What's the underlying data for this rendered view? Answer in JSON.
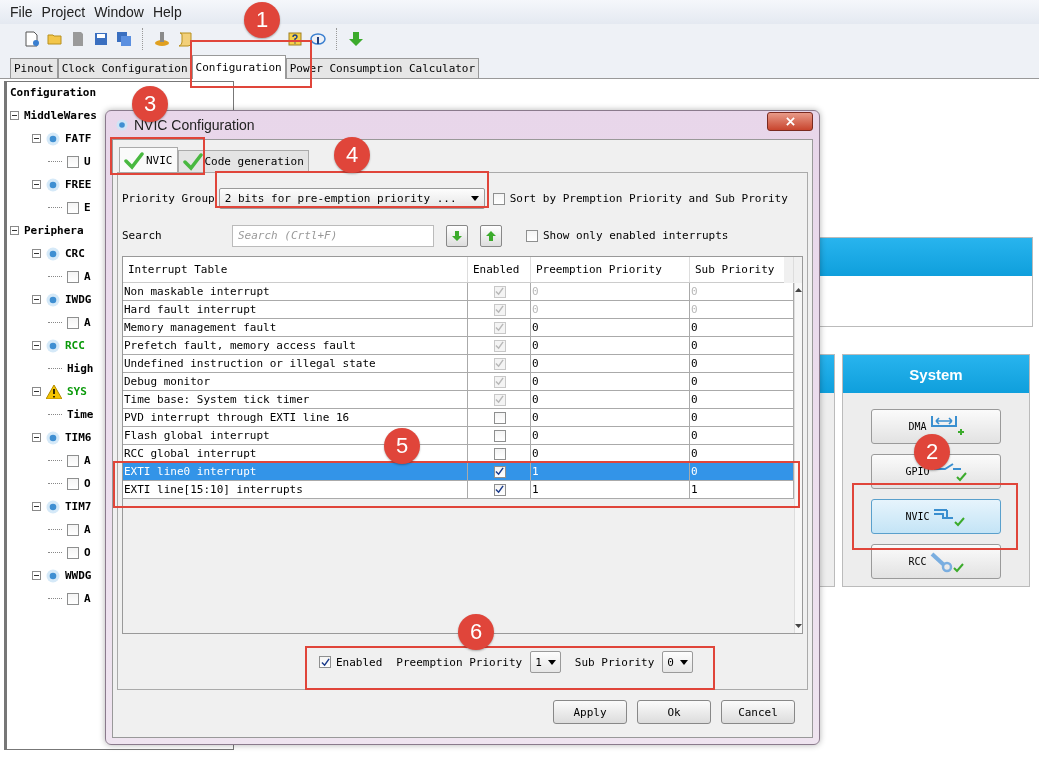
{
  "menu": [
    "File",
    "Project",
    "Window",
    "Help"
  ],
  "tabs": [
    {
      "label": "Pinout",
      "selected": false
    },
    {
      "label": "Clock Configuration",
      "selected": false
    },
    {
      "label": "Configuration",
      "selected": true
    },
    {
      "label": "Power Consumption Calculator",
      "selected": false
    }
  ],
  "tree": {
    "label": "Configuration",
    "children": [
      {
        "label": "MiddleWares",
        "kind": "group",
        "expanded": true,
        "children": [
          {
            "label": "FATF",
            "kind": "module",
            "expanded": true,
            "warning": false,
            "color": "#000000",
            "children": [
              {
                "label": "U",
                "kind": "checkbox",
                "checked": false
              }
            ]
          },
          {
            "label": "FREE",
            "kind": "module",
            "expanded": true,
            "warning": false,
            "color": "#000000",
            "children": [
              {
                "label": "E",
                "kind": "checkbox",
                "checked": false
              }
            ]
          }
        ]
      },
      {
        "label": "Periphera",
        "kind": "group",
        "expanded": true,
        "children": [
          {
            "label": "CRC",
            "kind": "module",
            "expanded": true,
            "warning": false,
            "color": "#000000",
            "children": [
              {
                "label": "A",
                "kind": "checkbox",
                "checked": false
              }
            ]
          },
          {
            "label": "IWDG",
            "kind": "module",
            "expanded": true,
            "warning": false,
            "color": "#000000",
            "children": [
              {
                "label": "A",
                "kind": "checkbox",
                "checked": false
              }
            ]
          },
          {
            "label": "RCC",
            "kind": "module",
            "expanded": true,
            "warning": false,
            "color": "#0a9a0a",
            "children": [
              {
                "label": "High",
                "kind": "text"
              }
            ]
          },
          {
            "label": "SYS",
            "kind": "module",
            "expanded": true,
            "warning": true,
            "color": "#0a9a0a",
            "children": [
              {
                "label": "Time",
                "kind": "text"
              }
            ]
          },
          {
            "label": "TIM6",
            "kind": "module",
            "expanded": true,
            "warning": false,
            "color": "#000000",
            "children": [
              {
                "label": "A",
                "kind": "checkbox",
                "checked": false
              },
              {
                "label": "O",
                "kind": "checkbox",
                "checked": false
              }
            ]
          },
          {
            "label": "TIM7",
            "kind": "module",
            "expanded": true,
            "warning": false,
            "color": "#000000",
            "children": [
              {
                "label": "A",
                "kind": "checkbox",
                "checked": false
              },
              {
                "label": "O",
                "kind": "checkbox",
                "checked": false
              }
            ]
          },
          {
            "label": "WWDG",
            "kind": "module",
            "expanded": true,
            "warning": false,
            "color": "#000000",
            "children": [
              {
                "label": "A",
                "kind": "checkbox",
                "checked": false
              }
            ]
          }
        ]
      }
    ]
  },
  "system": {
    "title": "System",
    "buttons": [
      {
        "label": "DMA",
        "kind": "dma",
        "selected": false
      },
      {
        "label": "GPIO",
        "kind": "gpio",
        "selected": false
      },
      {
        "label": "NVIC",
        "kind": "nvic",
        "selected": true
      },
      {
        "label": "RCC",
        "kind": "rcc",
        "selected": false
      }
    ]
  },
  "dialog": {
    "title": "NVIC Configuration",
    "tabs": [
      {
        "label": "NVIC",
        "selected": true
      },
      {
        "label": "Code generation",
        "selected": false
      }
    ],
    "priority_group": {
      "label": "Priority Group",
      "value": "2 bits for pre-emption priority ..."
    },
    "sort": {
      "label": "Sort by Premption Priority and Sub Prority",
      "checked": false
    },
    "search": {
      "label": "Search",
      "placeholder": "Search (Crtl+F)"
    },
    "show_enabled": {
      "label": "Show only enabled interrupts",
      "checked": false
    },
    "table": {
      "columns": [
        "Interrupt Table",
        "Enabled",
        "Preemption Priority",
        "Sub Priority"
      ],
      "rows": [
        {
          "name": "Non maskable interrupt",
          "enabled": true,
          "locked": true,
          "preemption": "0",
          "sub": "0",
          "greyed": true,
          "selected": false
        },
        {
          "name": "Hard fault interrupt",
          "enabled": true,
          "locked": true,
          "preemption": "0",
          "sub": "0",
          "greyed": true,
          "selected": false
        },
        {
          "name": "Memory management fault",
          "enabled": true,
          "locked": true,
          "preemption": "0",
          "sub": "0",
          "greyed": false,
          "selected": false
        },
        {
          "name": "Prefetch fault, memory access fault",
          "enabled": true,
          "locked": true,
          "preemption": "0",
          "sub": "0",
          "greyed": false,
          "selected": false
        },
        {
          "name": "Undefined instruction or illegal state",
          "enabled": true,
          "locked": true,
          "preemption": "0",
          "sub": "0",
          "greyed": false,
          "selected": false
        },
        {
          "name": "Debug monitor",
          "enabled": true,
          "locked": true,
          "preemption": "0",
          "sub": "0",
          "greyed": false,
          "selected": false
        },
        {
          "name": "Time base: System tick timer",
          "enabled": true,
          "locked": true,
          "preemption": "0",
          "sub": "0",
          "greyed": false,
          "selected": false
        },
        {
          "name": "PVD interrupt through EXTI line 16",
          "enabled": false,
          "locked": false,
          "preemption": "0",
          "sub": "0",
          "greyed": false,
          "selected": false
        },
        {
          "name": "Flash global interrupt",
          "enabled": false,
          "locked": false,
          "preemption": "0",
          "sub": "0",
          "greyed": false,
          "selected": false
        },
        {
          "name": "RCC global interrupt",
          "enabled": false,
          "locked": false,
          "preemption": "0",
          "sub": "0",
          "greyed": false,
          "selected": false
        },
        {
          "name": "EXTI line0 interrupt",
          "enabled": true,
          "locked": false,
          "preemption": "1",
          "sub": "0",
          "greyed": false,
          "selected": true
        },
        {
          "name": "EXTI line[15:10] interrupts",
          "enabled": true,
          "locked": false,
          "preemption": "1",
          "sub": "1",
          "greyed": false,
          "selected": false
        }
      ]
    },
    "footer": {
      "enabled": {
        "label": "Enabled",
        "checked": true
      },
      "preemption": {
        "label": "Preemption Priority",
        "value": "1"
      },
      "sub": {
        "label": "Sub Priority",
        "value": "0"
      }
    },
    "buttons": [
      "Apply",
      "Ok",
      "Cancel"
    ]
  },
  "annotations": [
    {
      "label": "1"
    },
    {
      "label": "2"
    },
    {
      "label": "3"
    },
    {
      "label": "4"
    },
    {
      "label": "5"
    },
    {
      "label": "6"
    }
  ]
}
